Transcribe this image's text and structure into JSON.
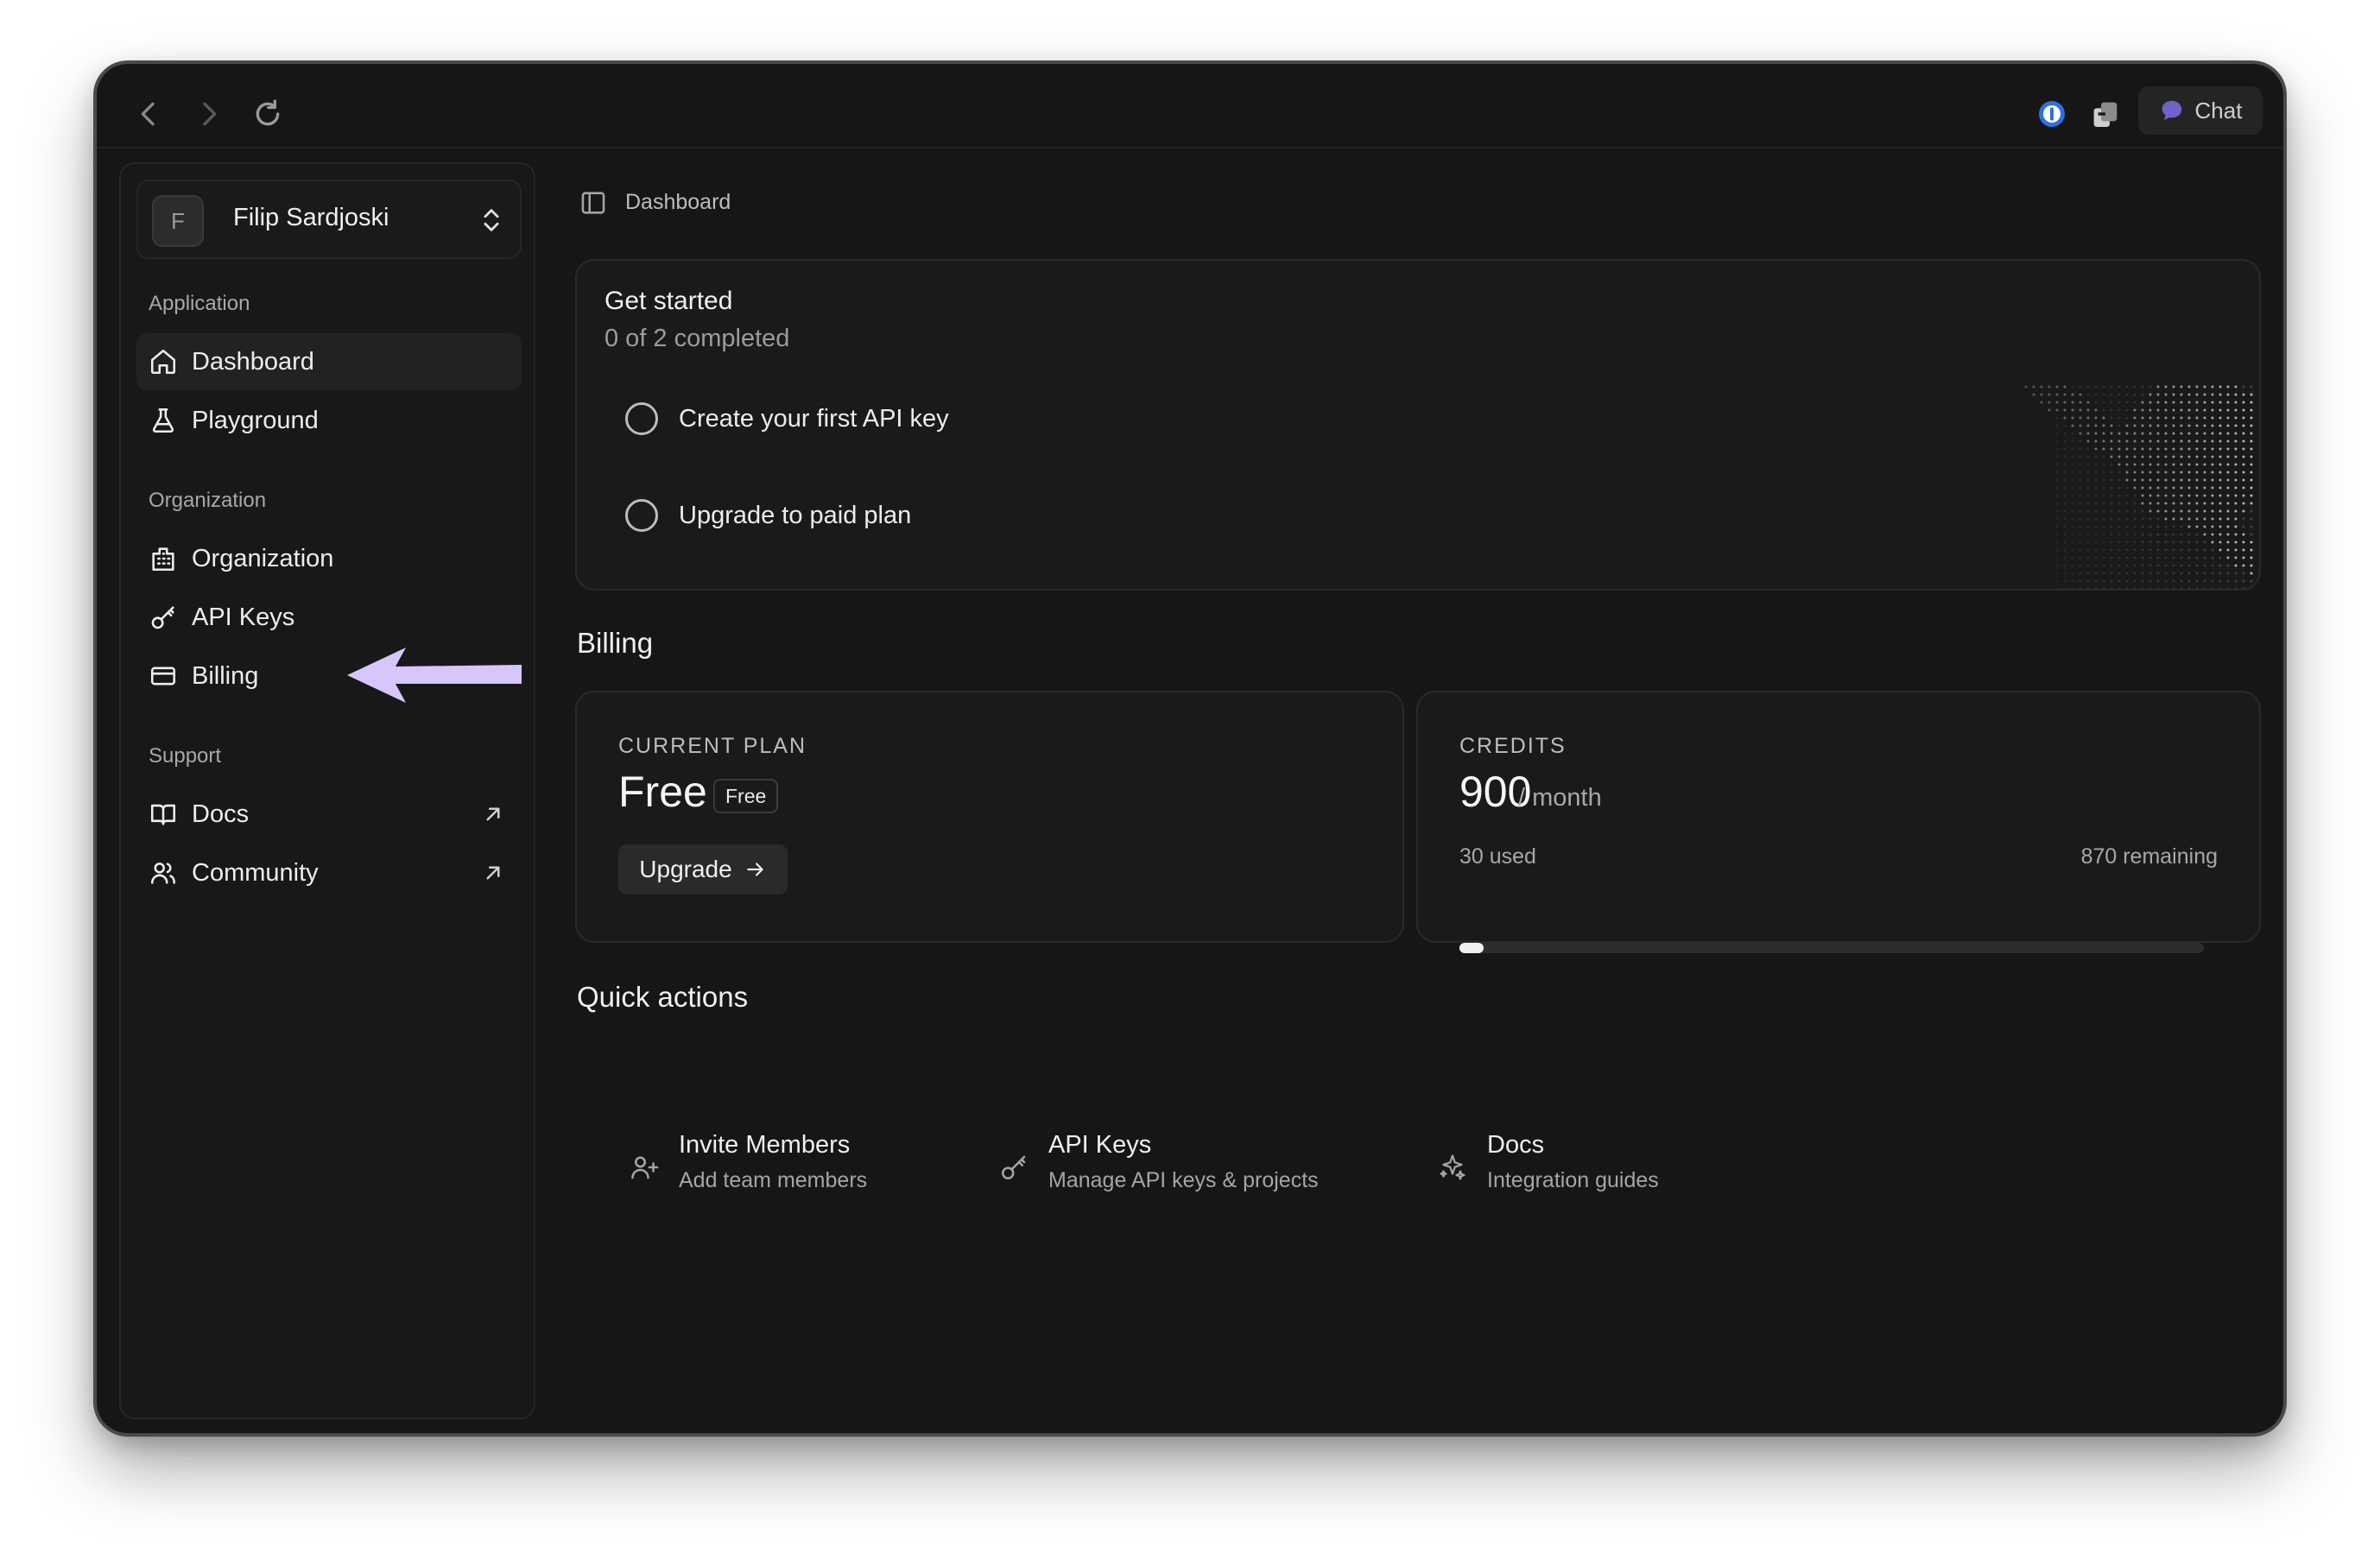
{
  "window": {
    "chat_label": "Chat"
  },
  "user": {
    "initial": "F",
    "name": "Filip Sardjoski"
  },
  "sidebar": {
    "sections": {
      "application": "Application",
      "organization": "Organization",
      "support": "Support"
    },
    "items": {
      "dashboard": "Dashboard",
      "playground": "Playground",
      "organization": "Organization",
      "api_keys": "API Keys",
      "billing": "Billing",
      "docs": "Docs",
      "community": "Community"
    },
    "active": "dashboard"
  },
  "breadcrumb": "Dashboard",
  "get_started": {
    "title": "Get started",
    "progress": "0 of 2 completed",
    "tasks": [
      "Create your first API key",
      "Upgrade to paid plan"
    ]
  },
  "billing": {
    "title": "Billing",
    "plan": {
      "caption": "CURRENT PLAN",
      "name": "Free",
      "badge": "Free",
      "upgrade_label": "Upgrade"
    },
    "credits": {
      "caption": "CREDITS",
      "amount": "900",
      "period": "/ month",
      "used": "30 used",
      "remaining": "870 remaining",
      "used_fraction": 0.033
    }
  },
  "quick_actions": {
    "title": "Quick actions",
    "items": [
      {
        "title": "Invite Members",
        "subtitle": "Add team members",
        "icon": "user-plus-icon"
      },
      {
        "title": "API Keys",
        "subtitle": "Manage API keys & projects",
        "icon": "key-icon"
      },
      {
        "title": "Docs",
        "subtitle": "Integration guides",
        "icon": "sparkles-icon"
      }
    ]
  },
  "colors": {
    "background": "#161616",
    "accent_arrow": "#d7c6fb",
    "chat_icon": "#6d63c9"
  }
}
